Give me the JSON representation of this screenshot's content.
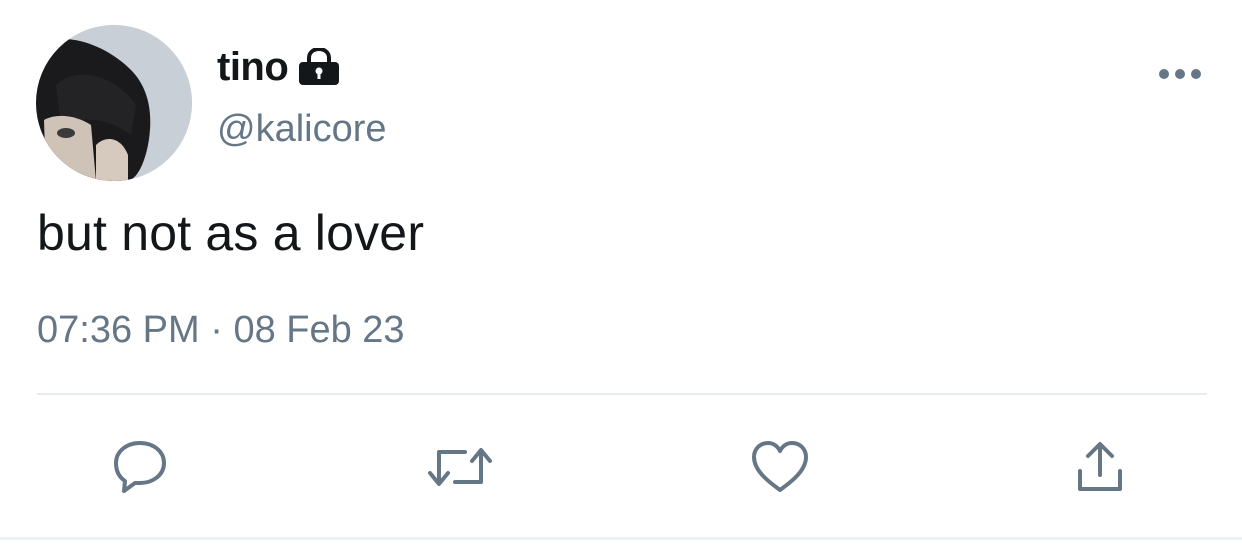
{
  "tweet": {
    "author": {
      "display_name": "tino",
      "handle": "@kalicore",
      "protected_icon": "lock-icon",
      "avatar_icon": "profile-photo"
    },
    "text": "but not as a lover",
    "time": "07:36 PM",
    "separator": " · ",
    "date": "08 Feb 23",
    "more_icon": "ellipsis-icon"
  },
  "actions": [
    {
      "icon": "reply-icon"
    },
    {
      "icon": "retweet-icon"
    },
    {
      "icon": "like-icon"
    },
    {
      "icon": "share-icon"
    }
  ],
  "colors": {
    "text_primary": "#14171a",
    "text_secondary": "#657786",
    "divider": "#e6ecf0",
    "icon": "#657786"
  }
}
